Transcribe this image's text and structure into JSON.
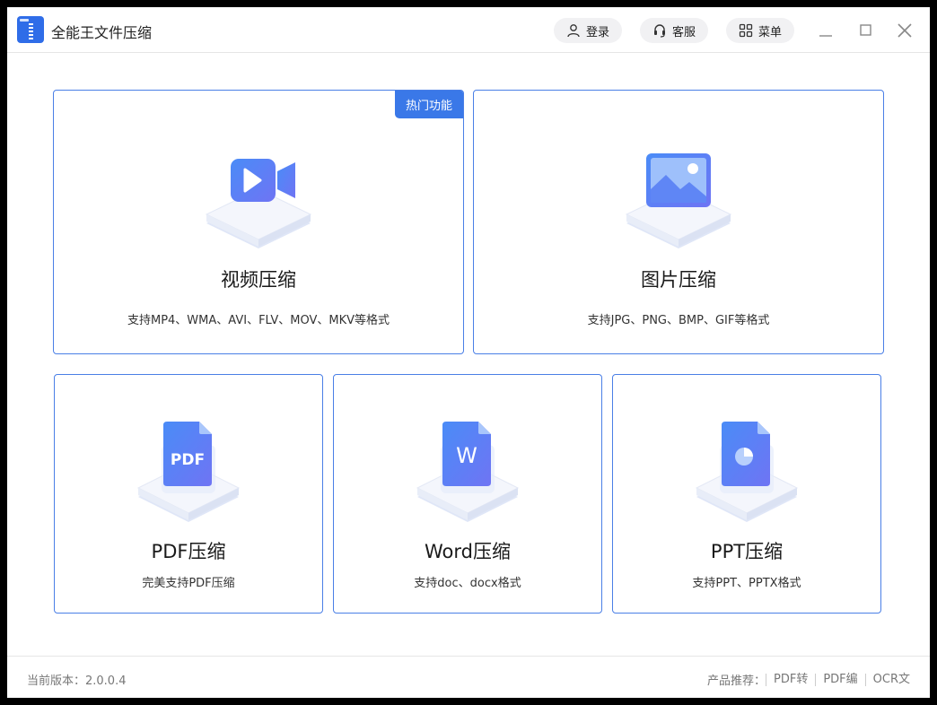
{
  "app": {
    "title": "全能王文件压缩",
    "logo_icon": "zip-file-icon"
  },
  "header": {
    "login_label": "登录",
    "service_label": "客服",
    "menu_label": "菜单"
  },
  "cards": {
    "video": {
      "badge": "热门功能",
      "title": "视频压缩",
      "desc": "支持MP4、WMA、AVI、FLV、MOV、MKV等格式",
      "icon": "video-camera-icon"
    },
    "image": {
      "title": "图片压缩",
      "desc": "支持JPG、PNG、BMP、GIF等格式",
      "icon": "image-icon"
    },
    "pdf": {
      "title": "PDF压缩",
      "desc": "完美支持PDF压缩",
      "icon": "pdf-file-icon",
      "icon_text": "PDF"
    },
    "word": {
      "title": "Word压缩",
      "desc": "支持doc、docx格式",
      "icon": "word-file-icon",
      "icon_text": "W"
    },
    "ppt": {
      "title": "PPT压缩",
      "desc": "支持PPT、PPTX格式",
      "icon": "ppt-file-icon"
    }
  },
  "footer": {
    "version": "当前版本：2.0.0.4",
    "recommend_label": "产品推荐：",
    "products": [
      "PDF转",
      "PDF编",
      "OCR文"
    ]
  },
  "colors": {
    "accent": "#3a78e8",
    "card_border": "#4a7fe6"
  }
}
